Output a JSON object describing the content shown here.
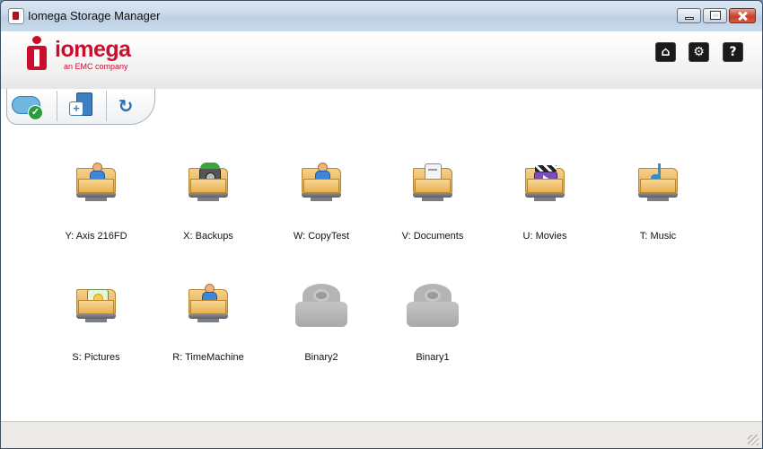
{
  "window": {
    "title": "Iomega Storage Manager",
    "icon": "app-icon",
    "controls": [
      "minimize-icon",
      "maximize-icon",
      "close-icon"
    ]
  },
  "header": {
    "logo_text": "iomega",
    "logo_sub": "an EMC company",
    "brand_color": "#c8102e",
    "buttons": [
      {
        "icon": "home-icon",
        "glyph": "⌂"
      },
      {
        "icon": "gear-icon",
        "glyph": "⚙"
      },
      {
        "icon": "help-icon",
        "glyph": "?"
      }
    ]
  },
  "toolbar": {
    "buttons": [
      {
        "icon": "cloud-check-icon"
      },
      {
        "icon": "add-device-icon"
      },
      {
        "icon": "refresh-icon",
        "glyph": "↻"
      }
    ]
  },
  "drives": [
    {
      "label": "Y: Axis 216FD",
      "icon": "person-folder-icon"
    },
    {
      "label": "X: Backups",
      "icon": "backup-folder-icon"
    },
    {
      "label": "W: CopyTest",
      "icon": "person-folder-icon"
    },
    {
      "label": "V: Documents",
      "icon": "document-folder-icon"
    },
    {
      "label": "U: Movies",
      "icon": "movie-folder-icon"
    },
    {
      "label": "T: Music",
      "icon": "music-folder-icon"
    },
    {
      "label": "S: Pictures",
      "icon": "picture-folder-icon"
    },
    {
      "label": "R: TimeMachine",
      "icon": "person-folder-icon"
    },
    {
      "label": "Binary2",
      "icon": "disk-icon"
    },
    {
      "label": "Binary1",
      "icon": "disk-icon"
    }
  ]
}
